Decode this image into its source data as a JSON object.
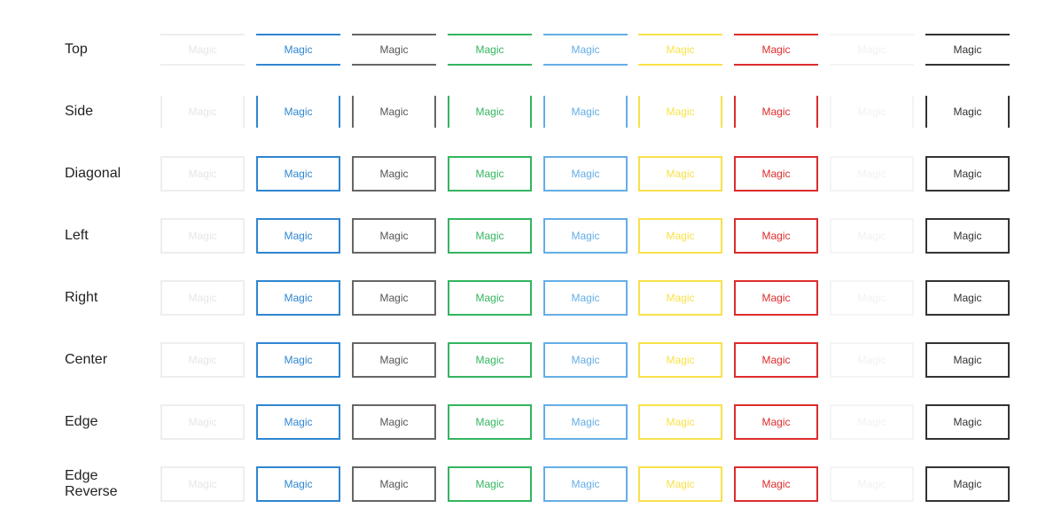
{
  "button_label": "Magic",
  "colors": [
    {
      "name": "light",
      "border": "#eeeeee",
      "text": "#e6e6e6"
    },
    {
      "name": "blue",
      "border": "#2f86d1",
      "text": "#2f86d1"
    },
    {
      "name": "gray",
      "border": "#666666",
      "text": "#555555"
    },
    {
      "name": "green",
      "border": "#34b560",
      "text": "#34b560"
    },
    {
      "name": "light-blue",
      "border": "#64aee6",
      "text": "#64aee6"
    },
    {
      "name": "yellow",
      "border": "#f8e14a",
      "text": "#f8e14a"
    },
    {
      "name": "red",
      "border": "#dd2c2c",
      "text": "#dd2c2c"
    },
    {
      "name": "white",
      "border": "#f4f4f4",
      "text": "#f2f2f2"
    },
    {
      "name": "dark",
      "border": "#333333",
      "text": "#333333"
    }
  ],
  "rows": [
    {
      "label": "Top",
      "style": "top"
    },
    {
      "label": "Side",
      "style": "side"
    },
    {
      "label": "Diagonal",
      "style": "box"
    },
    {
      "label": "Left",
      "style": "box"
    },
    {
      "label": "Right",
      "style": "box"
    },
    {
      "label": "Center",
      "style": "box"
    },
    {
      "label": "Edge",
      "style": "box"
    },
    {
      "label": "Edge\nReverse",
      "style": "box"
    }
  ]
}
